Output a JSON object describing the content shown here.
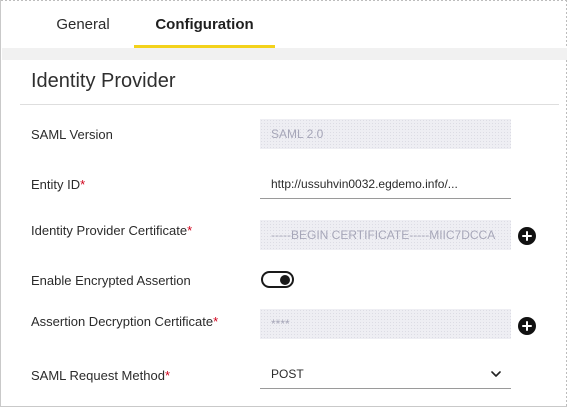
{
  "tabs": [
    {
      "label": "General",
      "active": false
    },
    {
      "label": "Configuration",
      "active": true
    }
  ],
  "section": {
    "title": "Identity Provider"
  },
  "form": {
    "saml_version": {
      "label": "SAML Version",
      "value": "SAML 2.0",
      "disabled": true
    },
    "entity_id": {
      "label": "Entity ID",
      "required_mark": "*",
      "value": "http://ussuhvin0032.egdemo.info/..."
    },
    "idp_certificate": {
      "label": "Identity Provider Certificate",
      "required_mark": "*",
      "value": "-----BEGIN CERTIFICATE-----MIIC7DCCA",
      "disabled": true,
      "add_icon": "plus-circle-icon"
    },
    "encrypted_assertion": {
      "label": "Enable Encrypted Assertion",
      "enabled": true
    },
    "decryption_certificate": {
      "label": "Assertion Decryption Certificate",
      "required_mark": "*",
      "value": "****",
      "disabled": true,
      "add_icon": "plus-circle-icon"
    },
    "request_method": {
      "label": "SAML Request Method",
      "required_mark": "*",
      "value": "POST",
      "dropdown_icon": "chevron-down-icon"
    }
  },
  "colors": {
    "active_tab_underline": "#f3d21b",
    "required": "#d0021b",
    "disabled_field_bg": "#eeeef3"
  }
}
